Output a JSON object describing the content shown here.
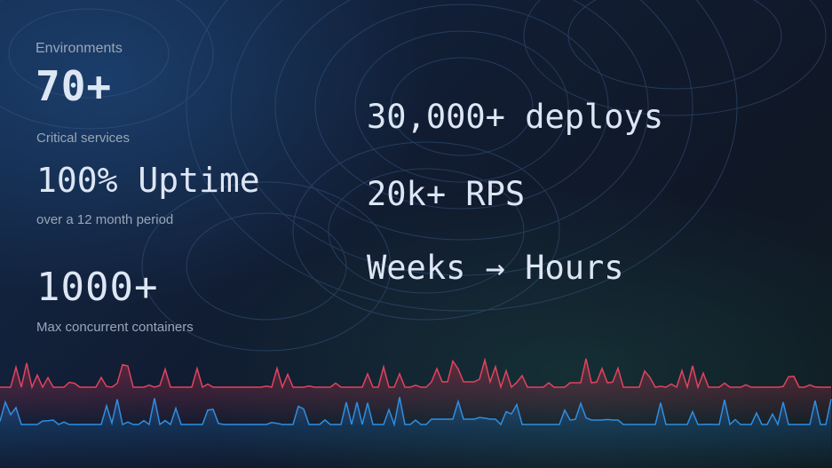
{
  "left": {
    "environments_label": "Environments",
    "environments_value": "70+",
    "critical_label": "Critical services",
    "uptime_value": "100% Uptime",
    "uptime_sub": "over a 12 month period",
    "containers_value": "1000+",
    "containers_label": "Max concurrent containers"
  },
  "right": {
    "deploys": "30,000+ deploys",
    "rps": "20k+ RPS",
    "weeks_hours": "Weeks → Hours"
  },
  "colors": {
    "red_line": "#e0445e",
    "blue_line": "#2f8ee0",
    "label": "#9aa6b8",
    "value": "#dde6f4"
  }
}
